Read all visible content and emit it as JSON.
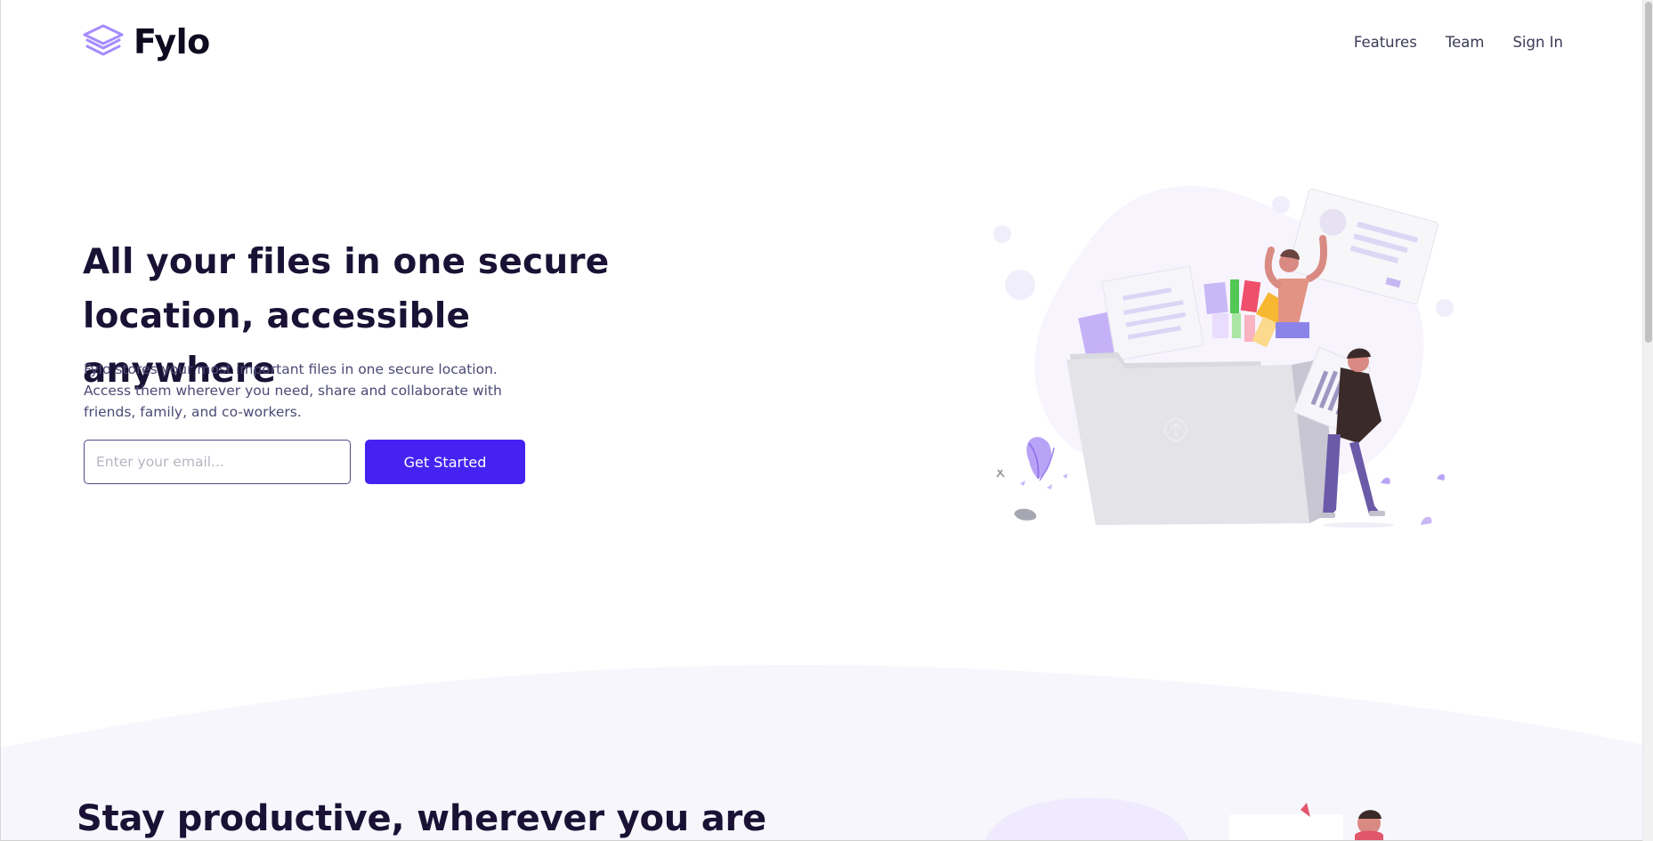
{
  "brand": {
    "name": "Fylo",
    "icon": "stacked-layers-icon",
    "icon_color": "#a58cff"
  },
  "nav": {
    "items": [
      "Features",
      "Team",
      "Sign In"
    ]
  },
  "hero": {
    "title_line1": "All your files in one secure",
    "title_line2": "location, accessible anywhere",
    "description": "Fylo stores your most important files in one secure location. Access them wherever you need, share and collaborate with friends, family, and co-workers.",
    "email_placeholder": "Enter your email...",
    "email_value": "",
    "cta_label": "Get Started",
    "illustration": "people-uploading-files-illustration"
  },
  "section2": {
    "title": "Stay productive, wherever you are",
    "illustration": "stay-productive-illustration"
  },
  "colors": {
    "accent": "#4522f2",
    "heading": "#1a1235",
    "body_text": "#4b4a75",
    "nav_text": "#3a3a56",
    "section_bg": "#f7f6fd"
  }
}
